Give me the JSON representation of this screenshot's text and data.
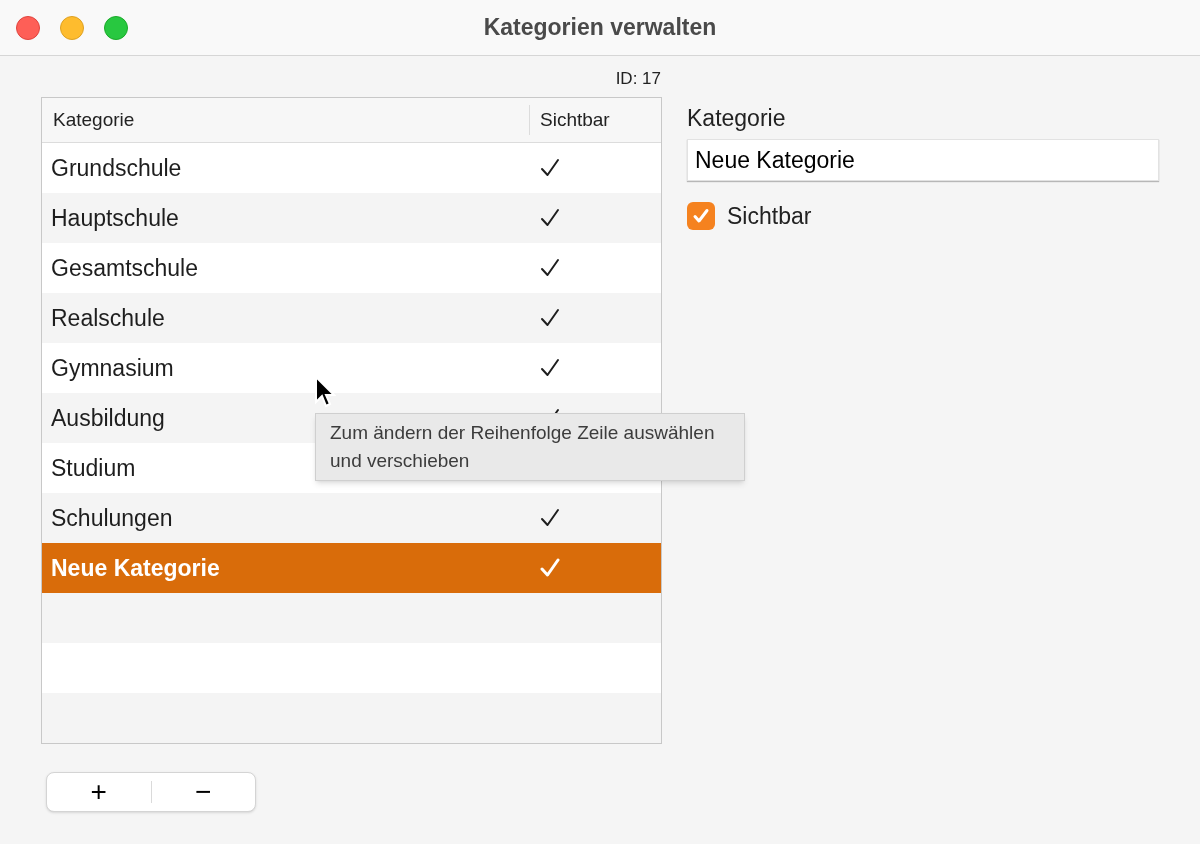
{
  "window": {
    "title": "Kategorien verwalten"
  },
  "record_id": "ID: 17",
  "table": {
    "columns": [
      "Kategorie",
      "Sichtbar"
    ],
    "rows": [
      {
        "name": "Grundschule",
        "visible": true,
        "selected": false
      },
      {
        "name": "Hauptschule",
        "visible": true,
        "selected": false
      },
      {
        "name": "Gesamtschule",
        "visible": true,
        "selected": false
      },
      {
        "name": "Realschule",
        "visible": true,
        "selected": false
      },
      {
        "name": "Gymnasium",
        "visible": true,
        "selected": false
      },
      {
        "name": "Ausbildung",
        "visible": true,
        "selected": false
      },
      {
        "name": "Studium",
        "selected": false
      },
      {
        "name": "Schulungen",
        "visible": true,
        "selected": false
      },
      {
        "name": "Neue Kategorie",
        "visible": true,
        "selected": true
      }
    ]
  },
  "tooltip": "Zum ändern der Reihenfolge Zeile auswählen und verschieben",
  "detail": {
    "label": "Kategorie",
    "value": "Neue Kategorie",
    "checkbox": {
      "label": "Sichtbar",
      "checked": true
    }
  },
  "buttons": [
    "+",
    "−"
  ]
}
